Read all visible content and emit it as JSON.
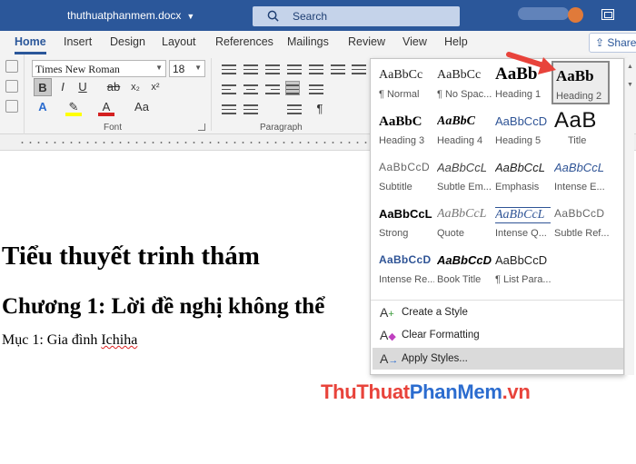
{
  "titlebar": {
    "document_name": "thuthuatphanmem.docx",
    "search_placeholder": "Search"
  },
  "tabs": [
    "Home",
    "Insert",
    "Design",
    "Layout",
    "References",
    "Mailings",
    "Review",
    "View",
    "Help"
  ],
  "active_tab": "Home",
  "share_label": "Share",
  "font": {
    "name": "Times New Roman",
    "size": "18",
    "group_label": "Font",
    "buttons": [
      "B",
      "I",
      "U",
      "ab",
      "x₂",
      "x²",
      "A",
      "A",
      "Aa"
    ]
  },
  "paragraph": {
    "group_label": "Paragraph"
  },
  "document": {
    "heading1": "Tiểu thuyết trinh thám",
    "heading2": "Chương 1: Lời đề nghị không thể",
    "body_prefix": "Mục 1: Gia đình ",
    "body_misspelled": "Ichiha"
  },
  "styles": [
    {
      "preview": "AaBbCc",
      "name": "¶ Normal"
    },
    {
      "preview": "AaBbCc",
      "name": "¶ No Spac..."
    },
    {
      "preview": "AaBb",
      "name": "Heading 1"
    },
    {
      "preview": "AaBb",
      "name": "Heading 2",
      "selected": true
    },
    {
      "preview": "AaBbC",
      "name": "Heading 3"
    },
    {
      "preview": "AaBbC",
      "name": "Heading 4"
    },
    {
      "preview": "AaBbCcD",
      "name": "Heading 5"
    },
    {
      "preview": "AaB",
      "name": "Title"
    },
    {
      "preview": "AaBbCcD",
      "name": "Subtitle"
    },
    {
      "preview": "AaBbCcL",
      "name": "Subtle Em..."
    },
    {
      "preview": "AaBbCcL",
      "name": "Emphasis"
    },
    {
      "preview": "AaBbCcL",
      "name": "Intense E..."
    },
    {
      "preview": "AaBbCcL",
      "name": "Strong"
    },
    {
      "preview": "AaBbCcL",
      "name": "Quote"
    },
    {
      "preview": "AaBbCcL",
      "name": "Intense Q..."
    },
    {
      "preview": "AaBbCcD",
      "name": "Subtle Ref..."
    },
    {
      "preview": "AaBbCcD",
      "name": "Intense Re..."
    },
    {
      "preview": "AaBbCcD",
      "name": "Book Title"
    },
    {
      "preview": "AaBbCcD",
      "name": "¶ List Para..."
    }
  ],
  "menu": {
    "create_style": "Create a Style",
    "clear_formatting": "Clear Formatting",
    "apply_styles": "Apply Styles..."
  },
  "watermark": {
    "part_red": "ThuThuat",
    "part_blue": "PhanMem",
    "part_red2": ".vn"
  },
  "colors": {
    "accent": "#2b579a",
    "arrow": "#e8433b"
  }
}
